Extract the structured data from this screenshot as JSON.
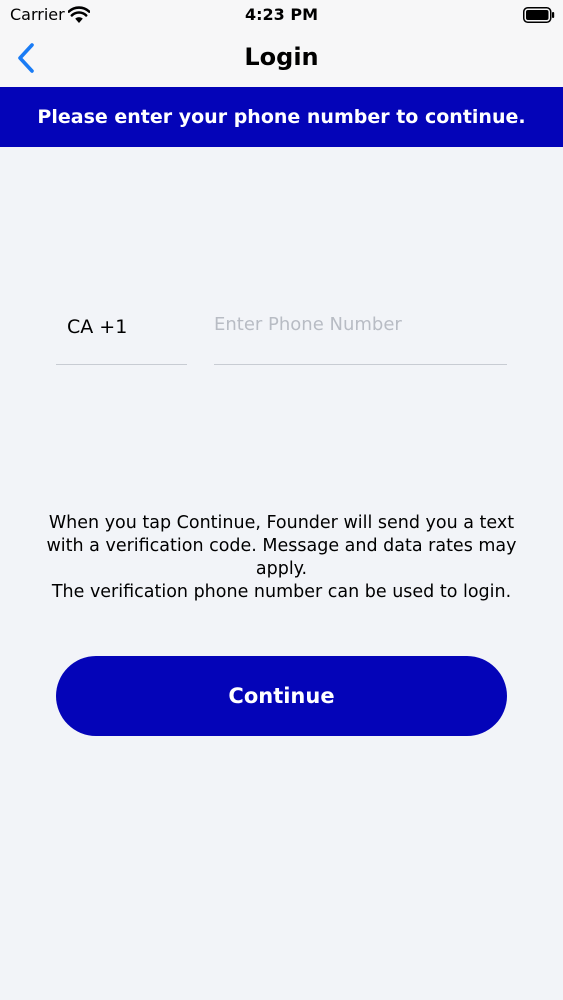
{
  "status_bar": {
    "carrier": "Carrier",
    "time": "4:23 PM",
    "icons": [
      "wifi-icon",
      "battery-icon"
    ]
  },
  "nav": {
    "back_icon": "chevron-left-icon",
    "title": "Login"
  },
  "banner": {
    "text": "Please enter your phone number to continue."
  },
  "form": {
    "country_code": "CA +1",
    "phone_value": "",
    "phone_placeholder": "Enter Phone Number"
  },
  "disclaimer": {
    "line1": "When you tap Continue, Founder will send you a text with a verification code. Message and data rates may apply.",
    "line2": "The verification phone number can be used to login."
  },
  "actions": {
    "continue_label": "Continue"
  },
  "colors": {
    "brand": "#0404b8",
    "accent": "#1a7cf5",
    "background": "#f2f4f8"
  }
}
